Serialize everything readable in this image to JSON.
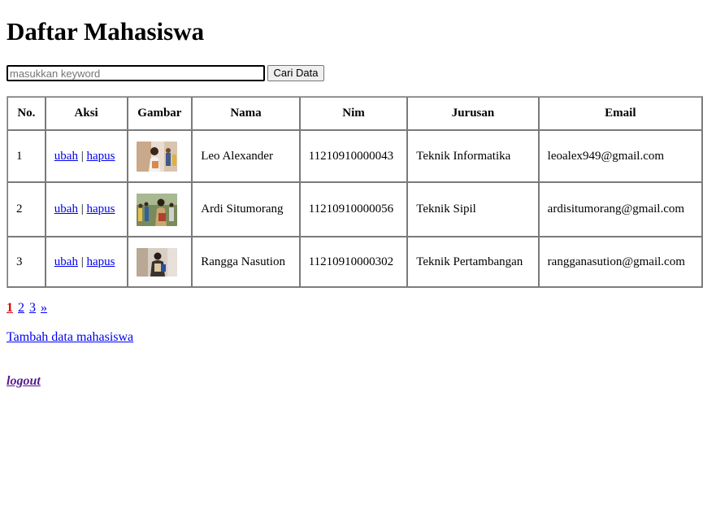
{
  "page": {
    "title": "Daftar Mahasiswa"
  },
  "search": {
    "placeholder": "masukkan keyword",
    "value": "",
    "button_label": "Cari Data"
  },
  "table": {
    "headers": [
      "No.",
      "Aksi",
      "Gambar",
      "Nama",
      "Nim",
      "Jurusan",
      "Email"
    ],
    "rows": [
      {
        "no": "1",
        "edit_label": "ubah",
        "separator": "|",
        "delete_label": "hapus",
        "photo_icon": "student-photo-icon",
        "nama": "Leo Alexander",
        "nim": "11210910000043",
        "jurusan": "Teknik Informatika",
        "email": "leoalex949@gmail.com"
      },
      {
        "no": "2",
        "edit_label": "ubah",
        "separator": "|",
        "delete_label": "hapus",
        "photo_icon": "student-photo-icon",
        "nama": "Ardi Situmorang",
        "nim": "11210910000056",
        "jurusan": "Teknik Sipil",
        "email": "ardisitumorang@gmail.com"
      },
      {
        "no": "3",
        "edit_label": "ubah",
        "separator": "|",
        "delete_label": "hapus",
        "photo_icon": "student-photo-icon",
        "nama": "Rangga Nasution",
        "nim": "11210910000302",
        "jurusan": "Teknik Pertambangan",
        "email": "rangganasution@gmail.com"
      }
    ]
  },
  "pagination": {
    "current": "1",
    "pages": [
      "2",
      "3"
    ],
    "next": "»"
  },
  "links": {
    "add_student": "Tambah data mahasiswa",
    "logout": "logout"
  },
  "colors": {
    "link": "#0000ee",
    "active_page": "#dd0000",
    "visited_link": "#551a8b"
  }
}
